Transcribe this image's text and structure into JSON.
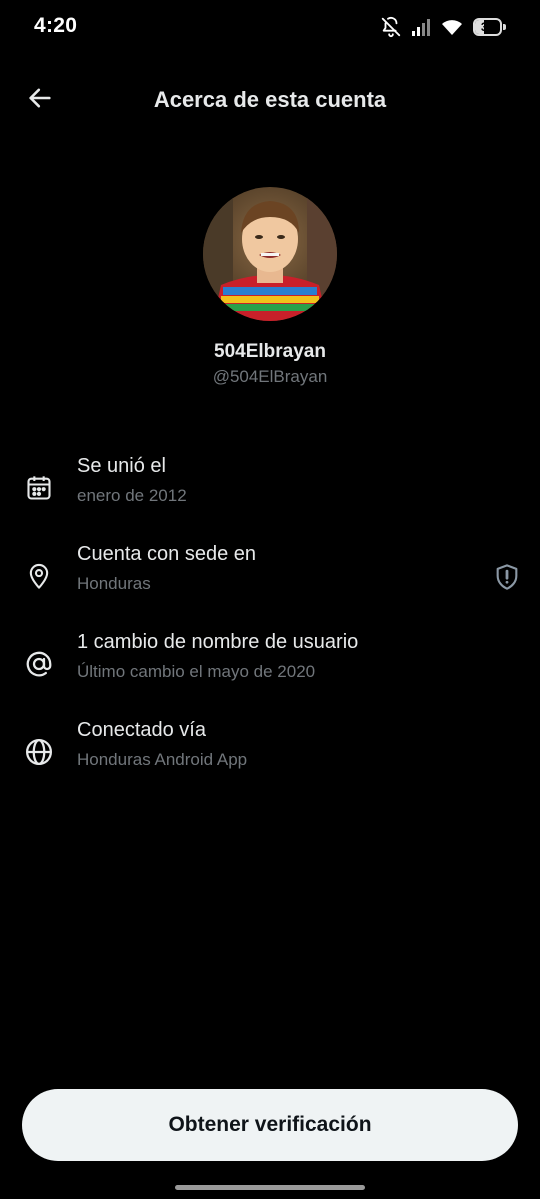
{
  "status_bar": {
    "time": "4:20",
    "battery_level": "35",
    "icons": [
      "bell-off-icon",
      "signal-icon",
      "wifi-icon",
      "battery-icon"
    ]
  },
  "header": {
    "title": "Acerca de esta cuenta",
    "back_icon": "arrow-left-icon"
  },
  "profile": {
    "display_name": "504Elbrayan",
    "handle": "@504ElBrayan"
  },
  "info_rows": [
    {
      "icon": "calendar-icon",
      "title": "Se unió el",
      "subtitle": "enero de 2012"
    },
    {
      "icon": "location-pin-icon",
      "title": "Cuenta con sede en",
      "subtitle": "Honduras",
      "trailing_icon": "shield-alert-icon"
    },
    {
      "icon": "at-sign-icon",
      "title": "1 cambio de nombre de usuario",
      "subtitle": "Último cambio el mayo de 2020"
    },
    {
      "icon": "globe-icon",
      "title": "Conectado vía",
      "subtitle": "Honduras Android App"
    }
  ],
  "actions": {
    "verify_label": "Obtener verificación"
  },
  "colors": {
    "background": "#000000",
    "text_primary": "#e7e9ea",
    "text_secondary": "#71767b",
    "button_bg": "#eff3f4",
    "button_text": "#0f1419"
  }
}
